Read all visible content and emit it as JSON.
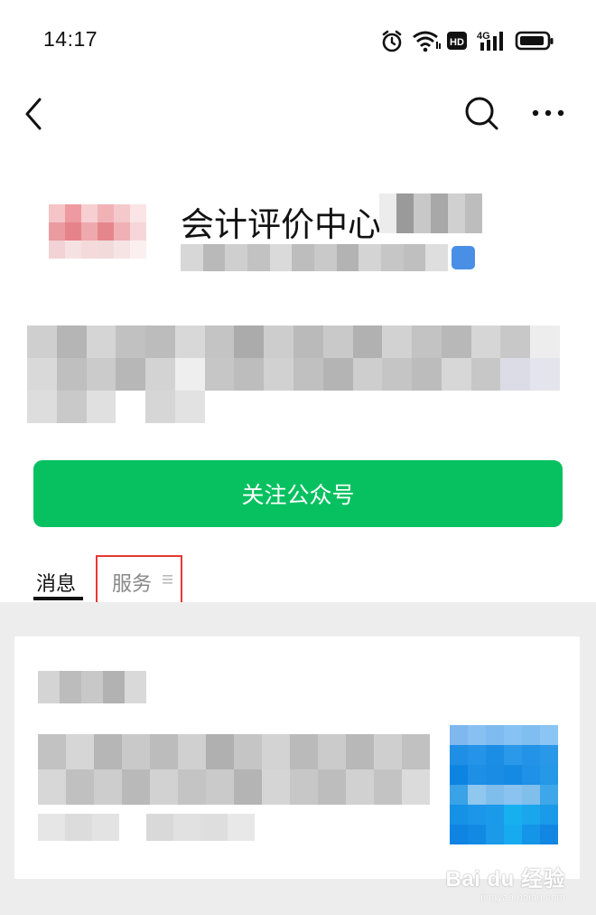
{
  "status_bar": {
    "time": "14:17",
    "icons": [
      "alarm-icon",
      "wifi-icon",
      "hd-icon",
      "signal-4g-icon",
      "battery-icon"
    ]
  },
  "nav": {
    "back_icon": "chevron-left-icon",
    "search_icon": "search-icon",
    "more_icon": "more-dots-icon"
  },
  "profile": {
    "name": "会计评价中心"
  },
  "follow_button": {
    "label": "关注公众号",
    "color": "#07c160"
  },
  "tabs": [
    {
      "label": "消息",
      "active": true
    },
    {
      "label": "服务",
      "active": false
    }
  ],
  "highlight_color": "#e53935",
  "watermark": {
    "brand": "Bai du 经验",
    "url": "jingyan.baidu.com"
  }
}
